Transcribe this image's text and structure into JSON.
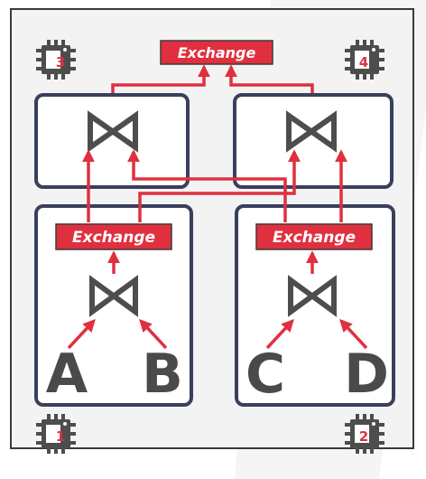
{
  "exchange_top": "Exchange",
  "exchange_left": "Exchange",
  "exchange_right": "Exchange",
  "relations": [
    "A",
    "B",
    "C",
    "D"
  ],
  "cpus": [
    "3",
    "4",
    "1",
    "2"
  ],
  "colors": {
    "accent": "#e0303f",
    "box": "#3a3f5c",
    "join": "#4d4d4d",
    "panel": "#f2f2f2"
  }
}
